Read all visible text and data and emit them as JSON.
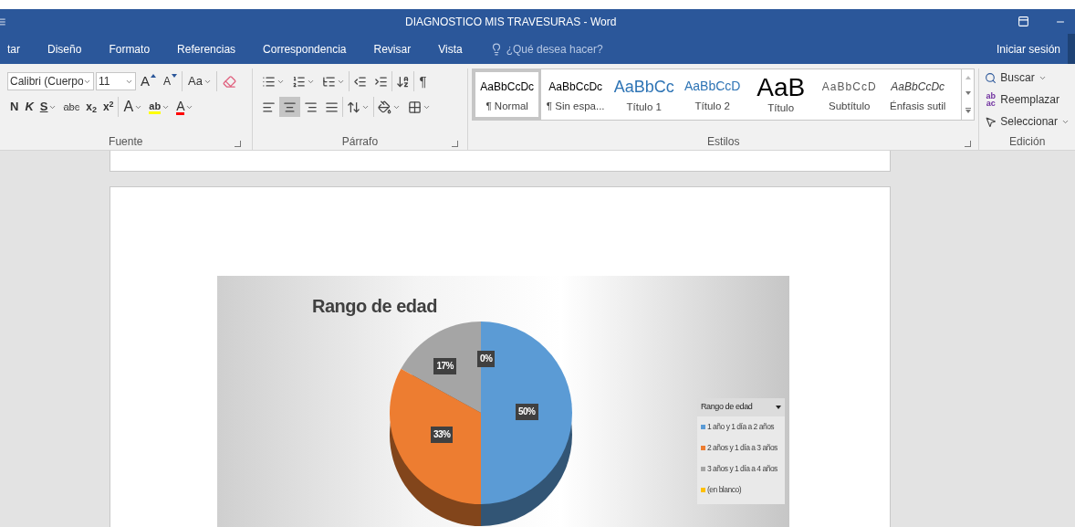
{
  "window": {
    "title": "DIAGNOSTICO MIS TRAVESURAS - Word"
  },
  "tabs": [
    {
      "label": "tar",
      "selected": false
    },
    {
      "label": "Diseño",
      "selected": false
    },
    {
      "label": "Formato",
      "selected": false
    },
    {
      "label": "Referencias",
      "selected": false
    },
    {
      "label": "Correspondencia",
      "selected": false
    },
    {
      "label": "Revisar",
      "selected": false
    },
    {
      "label": "Vista",
      "selected": false
    }
  ],
  "tell_me": {
    "placeholder": "¿Qué desea hacer?"
  },
  "sign_in": "Iniciar sesión",
  "font_group": {
    "label": "Fuente",
    "font_name": "Calibri (Cuerpo",
    "font_size": "11",
    "row1": [
      {
        "kind": "grow",
        "label": "A"
      },
      {
        "kind": "shrink",
        "label": "A"
      },
      {
        "kind": "case",
        "label": "Aa"
      },
      {
        "kind": "clear"
      }
    ],
    "row2": [
      {
        "kind": "bold",
        "label": "N"
      },
      {
        "kind": "italic",
        "label": "K"
      },
      {
        "kind": "underline",
        "label": "S"
      },
      {
        "kind": "strike",
        "label": "abc"
      },
      {
        "kind": "sub",
        "label": "x$_{2}$"
      },
      {
        "kind": "sup",
        "label": "x$^{2}$"
      },
      {
        "kind": "effects",
        "label": "A"
      },
      {
        "kind": "highlight",
        "label": "ab"
      },
      {
        "kind": "color",
        "label": "A"
      }
    ]
  },
  "paragraph_group": {
    "label": "Párrafo",
    "marks": "¶",
    "alignments": [
      {
        "kind": "left",
        "selected": false
      },
      {
        "kind": "center",
        "selected": true
      },
      {
        "kind": "right",
        "selected": false
      },
      {
        "kind": "justify",
        "selected": false
      }
    ]
  },
  "styles_group": {
    "label": "Estilos",
    "styles": [
      {
        "kind": "normal",
        "preview": "AaBbCcDc",
        "name": "¶ Normal",
        "selected": true
      },
      {
        "kind": "nospacing",
        "preview": "AaBbCcDc",
        "name": "¶ Sin espa...",
        "selected": false
      },
      {
        "kind": "heading1",
        "preview": "AaBbCc",
        "name": "Título 1",
        "selected": false
      },
      {
        "kind": "heading2",
        "preview": "AaBbCcD",
        "name": "Título 2",
        "selected": false
      },
      {
        "kind": "title",
        "preview": "AaB",
        "name": "Título",
        "selected": false
      },
      {
        "kind": "subtitle",
        "preview": "AaBbCcD",
        "name": "Subtítulo",
        "selected": false
      },
      {
        "kind": "emphasis",
        "preview": "AaBbCcDc",
        "name": "Énfasis sutil",
        "selected": false
      }
    ]
  },
  "editing_group": {
    "label": "Edición",
    "items": [
      {
        "kind": "find",
        "label": "Buscar"
      },
      {
        "kind": "replace",
        "label": "Reemplazar",
        "icon_text": [
          "ab",
          "ac"
        ]
      },
      {
        "kind": "select",
        "label": "Seleccionar"
      }
    ]
  },
  "chart": {
    "chart_data": {
      "type": "pie",
      "title": "Rango de edad",
      "categories": [
        "1 año y 1 día a 2 años",
        "2 años y 1 día a 3 años",
        "3 años y 1 día a 4 años",
        "(en blanco)"
      ],
      "series": [
        {
          "name": "Rango de edad",
          "values": [
            50,
            33,
            17,
            0
          ],
          "colors": [
            "#5b9bd5",
            "#ed7d31",
            "#a5a5a5",
            "#ffc000"
          ]
        }
      ],
      "value_labels": [
        "50%",
        "33%",
        "17%",
        "0%"
      ],
      "legend": "right"
    }
  }
}
